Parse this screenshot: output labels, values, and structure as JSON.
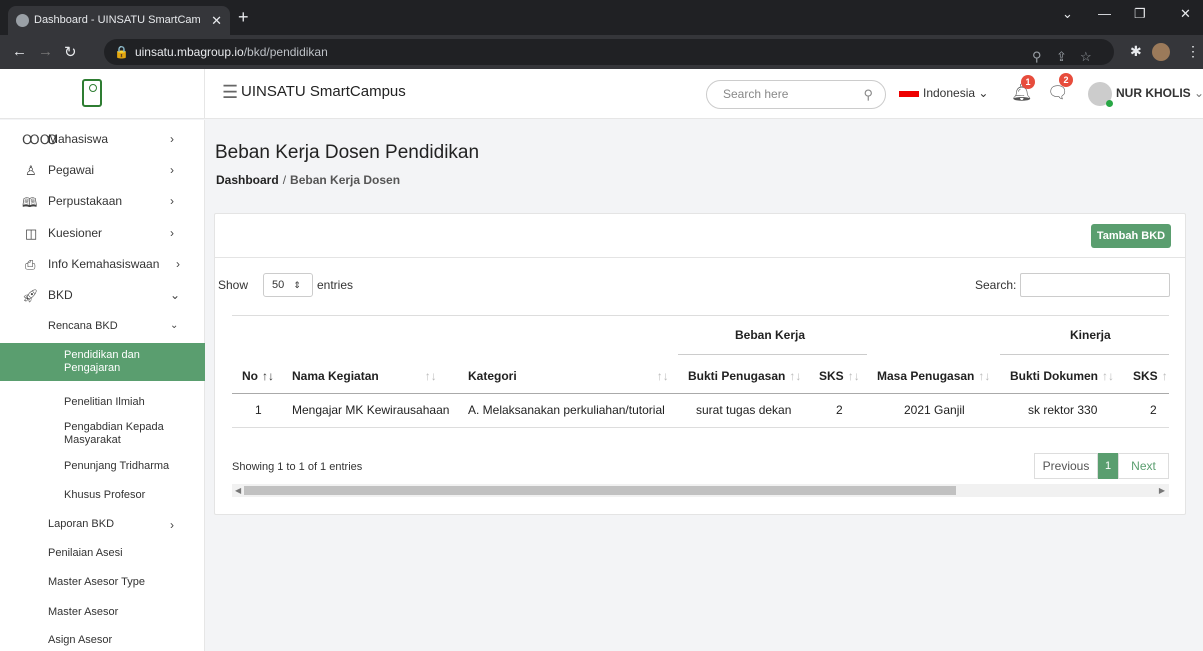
{
  "browser": {
    "tab_title": "Dashboard - UINSATU SmartCam",
    "url_host": "uinsatu.mbagroup.io",
    "url_path": "/bkd/pendidikan"
  },
  "header": {
    "app_name": "UINSATU SmartCampus",
    "search_placeholder": "Search here",
    "language": "Indonesia",
    "notification_count": "1",
    "message_count": "2",
    "user_name": "NUR KHOLIS"
  },
  "sidebar": {
    "items": [
      {
        "label": "Mahasiswa",
        "icon": "users-icon"
      },
      {
        "label": "Pegawai",
        "icon": "user-icon"
      },
      {
        "label": "Perpustakaan",
        "icon": "book-icon"
      },
      {
        "label": "Kuesioner",
        "icon": "clipboard-icon"
      },
      {
        "label": "Info Kemahasiswaan",
        "icon": "printer-icon"
      },
      {
        "label": "BKD",
        "icon": "rocket-icon"
      }
    ],
    "sub_rencana": "Rencana BKD",
    "sub_rencana_children": [
      "Pendidikan dan Pengajaran",
      "Penelitian Ilmiah",
      "Pengabdian Kepada Masyarakat",
      "Penunjang Tridharma",
      "Khusus Profesor"
    ],
    "others": [
      "Laporan BKD",
      "Penilaian Asesi",
      "Master Asesor Type",
      "Master Asesor",
      "Asign Asesor"
    ]
  },
  "page": {
    "title": "Beban Kerja Dosen Pendidikan",
    "breadcrumb_home": "Dashboard",
    "breadcrumb_sep": "/",
    "breadcrumb_current": "Beban Kerja Dosen",
    "add_button": "Tambah BKD",
    "show_label": "Show",
    "entries_value": "50",
    "entries_label": "entries",
    "search_label": "Search:"
  },
  "table": {
    "group_headers": [
      "Beban Kerja",
      "Kinerja"
    ],
    "columns": [
      "No",
      "Nama Kegiatan",
      "Kategori",
      "Bukti Penugasan",
      "SKS",
      "Masa Penugasan",
      "Bukti Dokumen",
      "SKS"
    ],
    "rows": [
      [
        "1",
        "Mengajar MK Kewirausahaan",
        "A. Melaksanakan perkuliahan/tutorial",
        "surat tugas dekan",
        "2",
        "2021 Ganjil",
        "sk rektor 330",
        "2"
      ]
    ]
  },
  "footer": {
    "info": "Showing 1 to 1 of 1 entries",
    "prev": "Previous",
    "page": "1",
    "next": "Next"
  }
}
